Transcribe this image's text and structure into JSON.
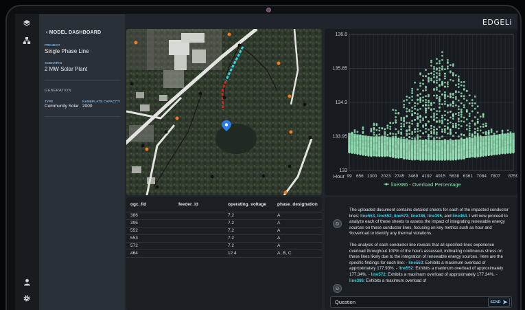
{
  "app": {
    "brand": "EDGELi"
  },
  "sidebar_nav": {
    "items": [
      {
        "icon": "layers-icon"
      },
      {
        "icon": "network-icon"
      }
    ],
    "bottom": [
      {
        "icon": "user-icon"
      },
      {
        "icon": "gear-icon"
      }
    ]
  },
  "left_panel": {
    "back_label": "MODEL DASHBOARD",
    "project_label": "PROJECT",
    "project_value": "Single Phase Line",
    "scenario_label": "SCENARIO",
    "scenario_value": "2 MW Solar Plant",
    "generation_heading": "GENERATION",
    "type_label": "TYPE",
    "type_value": "Community Solar",
    "capacity_label": "NAMEPLATE CAPACITY",
    "capacity_value": "2000"
  },
  "map": {
    "marker_icon": "location-pin-icon"
  },
  "chart_data": {
    "type": "scatter",
    "xlabel": "Hour",
    "ylabel": "",
    "legend": "line386 - Overload Percentage",
    "legend_placement": "bottom",
    "x_ticks": [
      "99",
      "656",
      "1300",
      "2023",
      "2745",
      "3469",
      "4192",
      "4915",
      "5638",
      "6361",
      "7084",
      "7807",
      "8759"
    ],
    "y_ticks": [
      "136.8",
      "135.85",
      "134.9",
      "133.95",
      "133"
    ],
    "xlim": [
      99,
      8759
    ],
    "ylim": [
      133,
      136.8
    ],
    "grid": true,
    "color": "#8fe0b0",
    "series": [
      {
        "x": [
          99,
          656,
          1300,
          2023,
          2745,
          3469,
          4192,
          4915,
          5638,
          6361,
          7084,
          7807,
          8759
        ],
        "y_max": [
          134.0,
          134.1,
          134.3,
          134.4,
          134.8,
          135.3,
          135.9,
          136.3,
          135.9,
          135.3,
          134.6,
          134.1,
          134.0
        ],
        "y_min": [
          133.5,
          133.45,
          133.4,
          133.4,
          133.35,
          133.3,
          133.3,
          133.3,
          133.3,
          133.35,
          133.4,
          133.45,
          133.5
        ]
      }
    ]
  },
  "table": {
    "columns": [
      "ogc_fid",
      "feeder_id",
      "operating_voltage",
      "phase_designation"
    ],
    "rows": [
      [
        "386",
        "",
        "7.2",
        "A"
      ],
      [
        "395",
        "",
        "7.2",
        "A"
      ],
      [
        "552",
        "",
        "7.2",
        "A"
      ],
      [
        "553",
        "",
        "7.2",
        "A"
      ],
      [
        "572",
        "",
        "7.2",
        "A"
      ],
      [
        "464",
        "",
        "12.4",
        "A, B, C"
      ]
    ]
  },
  "chat": {
    "msg1_a": "The uploaded document contains detailed sheets for each of the impacted conductor lines: ",
    "l553": "line553",
    "l552": "line552",
    "l572": "line572",
    "l386": "line386",
    "l395": "line395",
    "l464": "line464",
    "msg1_b": ". I will now proceed to analyze each of these sheets to assess the impact of integrating renewable energy sources on these conductor lines, focusing on key metrics such as hour and %overload to identify any thermal violations.",
    "msg2_a": "The analysis of each conductor line reveals that all specified lines experience overload throughout 100% of the hours assessed, indicating continuous stress on these lines likely due to the integration of renewable energy sources. Here are the specific findings for each line: - ",
    "f553": ": Exhibits a maximum overload of approximately 177.93%. - ",
    "f552": ": Exhibits a maximum overload of approximately 177.34%. - ",
    "f572": ": Exhibits a maximum overload of approximately 177.34%. - ",
    "f386": ": Exhibits a maximum overload of",
    "input_placeholder": "Question",
    "send_label": "SEND"
  }
}
